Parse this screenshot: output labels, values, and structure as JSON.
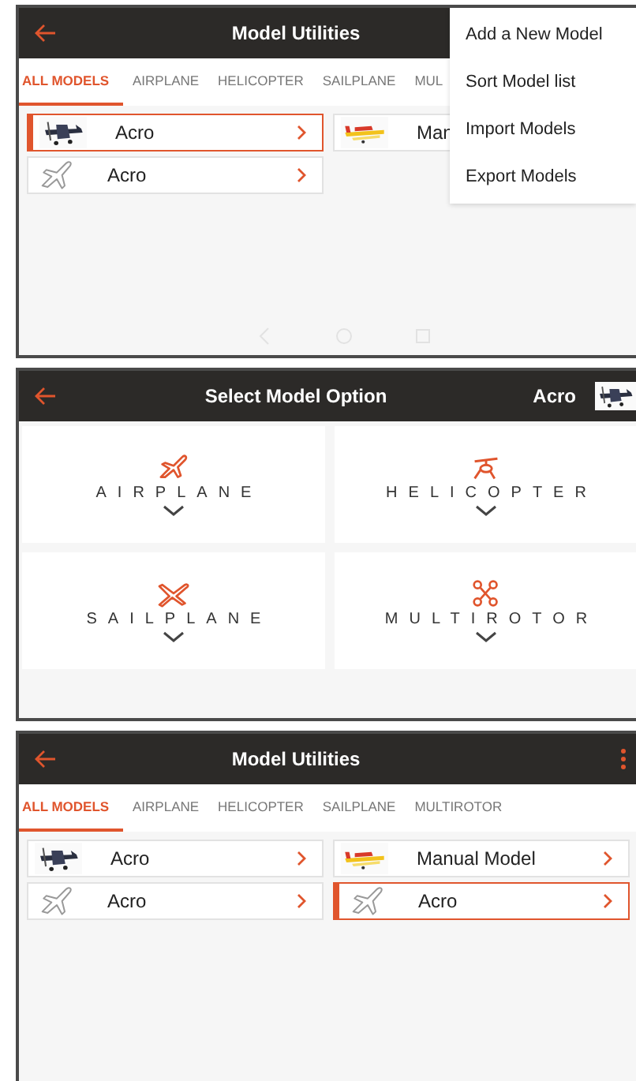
{
  "screens": [
    {
      "kind": "models",
      "title": "Model Utilities",
      "tabs": [
        {
          "label": "ALL MODELS",
          "selected": true
        },
        {
          "label": "AIRPLANE",
          "selected": false
        },
        {
          "label": "HELICOPTER",
          "selected": false
        },
        {
          "label": "SAILPLANE",
          "selected": false
        },
        {
          "label": "MUL",
          "selected": false
        }
      ],
      "models": [
        {
          "name": "Acro",
          "kind": "picture",
          "selected": true,
          "chevron": true
        },
        {
          "name": "Man",
          "kind": "picture",
          "selected": false,
          "chevron": false
        },
        {
          "name": "Acro",
          "kind": "icon",
          "selected": false,
          "chevron": true
        }
      ],
      "menu": [
        "Add a New Model",
        "Sort Model list",
        "Import Models",
        "Export Models"
      ],
      "nav_bar": true
    },
    {
      "kind": "options",
      "title": "Select Model Option",
      "model": {
        "name": "Acro",
        "kind": "picture"
      },
      "options": [
        {
          "label": "AIRPLANE"
        },
        {
          "label": "HELICOPTER"
        },
        {
          "label": "SAILPLANE"
        },
        {
          "label": "MULTIROTOR"
        }
      ]
    },
    {
      "kind": "models",
      "title": "Model Utilities",
      "menu_button": true,
      "tabs": [
        {
          "label": "ALL MODELS",
          "selected": true
        },
        {
          "label": "AIRPLANE",
          "selected": false
        },
        {
          "label": "HELICOPTER",
          "selected": false
        },
        {
          "label": "SAILPLANE",
          "selected": false
        },
        {
          "label": "MULTIROTOR",
          "selected": false
        }
      ],
      "models": [
        {
          "name": "Acro",
          "kind": "picture",
          "selected": false,
          "chevron": true
        },
        {
          "name": "Manual Model",
          "kind": "picture",
          "selected": false,
          "chevron": true
        },
        {
          "name": "Acro",
          "kind": "icon",
          "selected": false,
          "chevron": true
        },
        {
          "name": "Acro",
          "kind": "icon",
          "selected": true,
          "chevron": true
        }
      ]
    }
  ]
}
